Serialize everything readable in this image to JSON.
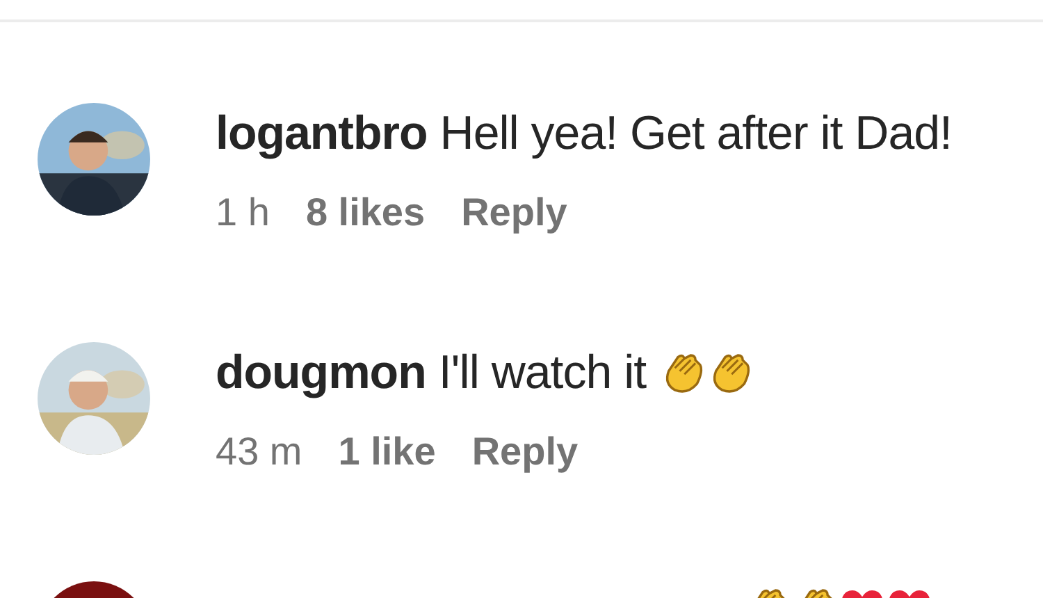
{
  "comments": [
    {
      "username": "logantbro",
      "text": "Hell yea! Get after it Dad!",
      "time": "1 h",
      "likes": "8 likes",
      "reply": "Reply",
      "avatar": {
        "kind": "picture"
      }
    },
    {
      "username": "dougmon",
      "text": "I'll watch it",
      "emojis": [
        {
          "kind": "clap"
        },
        {
          "kind": "clap"
        }
      ],
      "time": "43 m",
      "likes": "1 like",
      "reply": "Reply",
      "avatar": {
        "kind": "picture"
      }
    },
    {
      "emojis": [
        {
          "kind": "clap"
        },
        {
          "kind": "clap"
        },
        {
          "kind": "heart"
        },
        {
          "kind": "heart"
        }
      ],
      "avatar": {
        "kind": "picture"
      }
    }
  ]
}
